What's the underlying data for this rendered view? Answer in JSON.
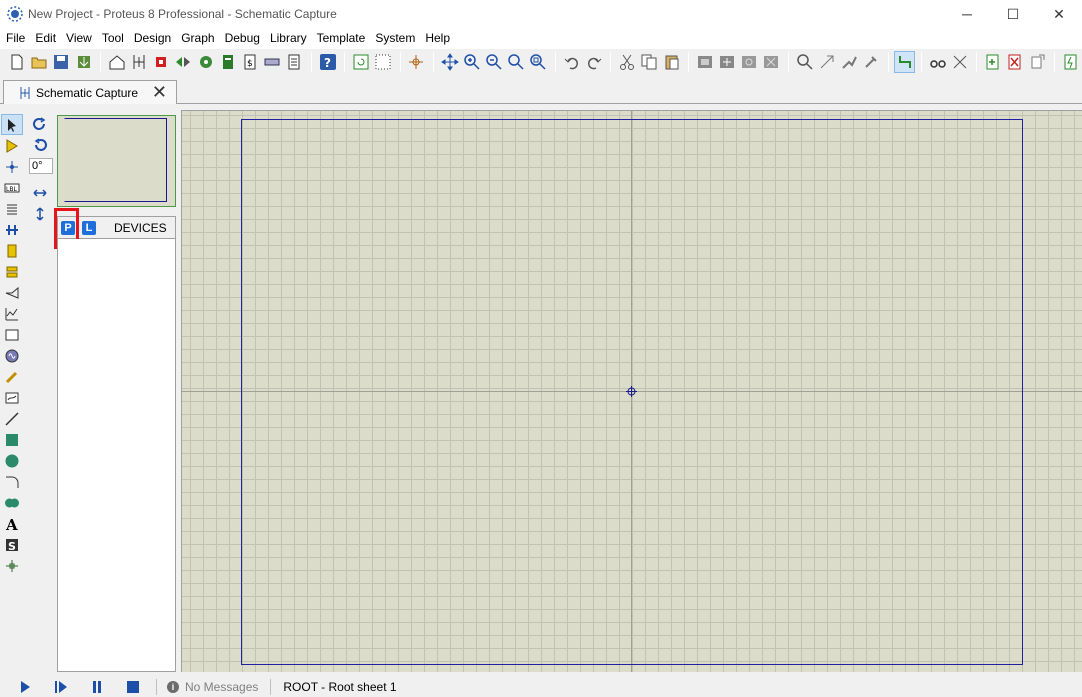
{
  "window": {
    "title": "New Project - Proteus 8 Professional - Schematic Capture",
    "minimize": "─",
    "maximize": "☐",
    "close": "✕"
  },
  "menu": [
    "File",
    "Edit",
    "View",
    "Tool",
    "Design",
    "Graph",
    "Debug",
    "Library",
    "Template",
    "System",
    "Help"
  ],
  "tab": {
    "label": "Schematic Capture",
    "close": "✕"
  },
  "rotation": {
    "angle": "0°"
  },
  "devices": {
    "pick_label": "P",
    "library_label": "L",
    "title": "DEVICES"
  },
  "status": {
    "messages": "No Messages",
    "sheet": "ROOT - Root sheet 1"
  },
  "colors": {
    "canvas": "#dcdccb",
    "sheet_border": "#2020a0",
    "highlight": "#e8141b",
    "accent": "#1e6fd9"
  }
}
